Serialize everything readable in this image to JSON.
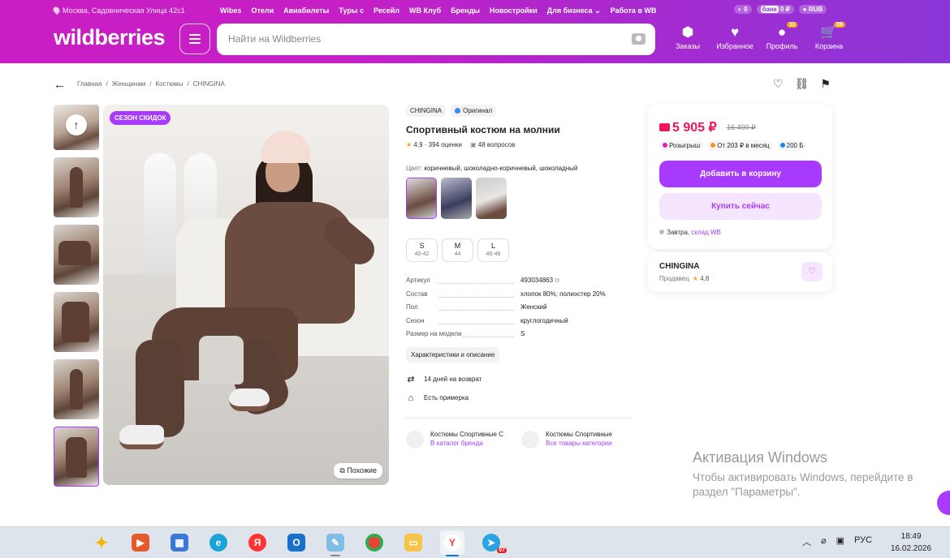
{
  "header": {
    "address": "Москва, Садовническая Улица 42с1",
    "nav": [
      "Wibes",
      "Отели",
      "Авиабилеты",
      "Туры с",
      "Ресейл",
      "WB Клуб",
      "Бренды",
      "Новостройки",
      "Для бизнеса",
      "Работа в WB"
    ],
    "tours_badge": "",
    "wallet_points": "0",
    "bank_label": "банк",
    "bank_balance": "0 ₽",
    "currency": "RUB",
    "logo": "wildberries",
    "search_placeholder": "Найти на Wildberries",
    "icons": [
      {
        "label": "Заказы",
        "icon": "box-icon",
        "glyph": "⬢"
      },
      {
        "label": "Избранное",
        "icon": "heart-icon",
        "glyph": "♥"
      },
      {
        "label": "Профиль",
        "icon": "user-icon",
        "glyph": "●",
        "badge": "11"
      },
      {
        "label": "Корзина",
        "icon": "cart-icon",
        "glyph": "🛒",
        "badge": "26"
      }
    ]
  },
  "breadcrumb": [
    "Главная",
    "Женщинам",
    "Костюмы",
    "CHINGINA"
  ],
  "gallery": {
    "sale_badge": "СЕЗОН СКИДОК",
    "similar_label": "Похожие"
  },
  "product": {
    "brand": "CHINGINA",
    "original_label": "Оригинал",
    "title": "Спортивный костюм на молнии",
    "rating": "4,9",
    "reviews": "394 оценки",
    "questions": "48 вопросов",
    "color_label": "Цвет:",
    "color_value": "коричневый, шоколадно-коричневый, шоколадный",
    "sizes": [
      {
        "size": "S",
        "ru": "40-42"
      },
      {
        "size": "M",
        "ru": "44"
      },
      {
        "size": "L",
        "ru": "46-48"
      }
    ],
    "specs": [
      {
        "k": "Артикул",
        "v": "493034863"
      },
      {
        "k": "Состав",
        "v": "хлопок 80%; полиэстер 20%"
      },
      {
        "k": "Пол",
        "v": "Женский"
      },
      {
        "k": "Сезон",
        "v": "круглогодичный"
      },
      {
        "k": "Размер на модели",
        "v": "S"
      }
    ],
    "chars_button": "Характеристики и описание",
    "return_label": "14 дней на возврат",
    "fitting_label": "Есть примерка",
    "cats": [
      {
        "t1": "Костюмы Спортивные С",
        "t2": "В каталог бренда"
      },
      {
        "t1": "Костюмы Спортивные",
        "t2": "Все товары категории"
      }
    ]
  },
  "buy": {
    "price": "5 905 ₽",
    "old_price": "16 400 ₽",
    "chips": [
      "Розыгрыш",
      "От 203 ₽ в месяц",
      "200 Б"
    ],
    "add_to_cart": "Добавить в корзину",
    "buy_now": "Купить сейчас",
    "delivery_day": "Завтра,",
    "delivery_wh": "склад WB"
  },
  "seller": {
    "name": "CHINGINA",
    "label": "Продавец",
    "rating": "4,8"
  },
  "watermark": {
    "title": "Активация Windows",
    "line1": "Чтобы активировать Windows, перейдите в",
    "line2": "раздел \"Параметры\"."
  },
  "taskbar": {
    "lang": "РУС",
    "time": "18:49",
    "date": "16.02.2026",
    "tg_count": "07"
  },
  "colors": {
    "accent": "#a73afd",
    "price": "#f0145a",
    "header_start": "#c81ec4",
    "header_end": "#8a37d8"
  }
}
